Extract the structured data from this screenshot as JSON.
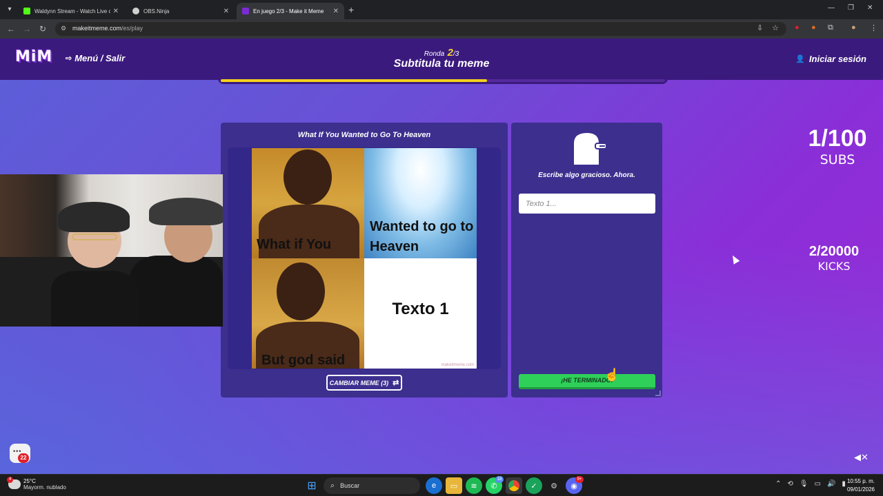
{
  "browser": {
    "tabs": [
      {
        "title": "Waldynn Stream - Watch Live o",
        "favicon_color": "#53fc18"
      },
      {
        "title": "OBS.Ninja",
        "favicon_color": "#cfcfcf"
      },
      {
        "title": "En juego 2/3 - Make it Meme",
        "favicon_color": "#7b2bd6"
      }
    ],
    "url_domain": "makeitmeme.com",
    "url_path": "/es/play"
  },
  "header": {
    "logo": "MiM",
    "menu_label": "Menú / Salir",
    "round_label": "Ronda",
    "round_current": "2",
    "round_total": "/3",
    "title": "Subtitula tu meme",
    "login_label": "Iniciar sesión",
    "progress": 0.6
  },
  "meme": {
    "title": "What If You Wanted to Go To Heaven",
    "captions": [
      "What if You",
      "Wanted to go to Heaven",
      "But god said",
      "Texto 1"
    ],
    "watermark": "makeitmeme.com",
    "change_button": "CAMBIAR MEME (3)"
  },
  "write": {
    "prompt": "Escribe algo gracioso. Ahora.",
    "input_placeholder": "Texto 1...",
    "done_button": "¡HE TERMINADO!"
  },
  "overlay": {
    "subs_count": "1/100",
    "subs_label": "SUBS",
    "kicks_count": "2/20000",
    "kicks_label": "KICKS",
    "chat_badge": "22"
  },
  "taskbar": {
    "weather_alert": "4",
    "temperature": "25°C",
    "condition": "Mayorm. nublado",
    "search_label": "Buscar",
    "whatsapp_badge": "18",
    "discord_badge": "9+",
    "time": "10:55 p. m.",
    "date": "09/01/2026"
  }
}
